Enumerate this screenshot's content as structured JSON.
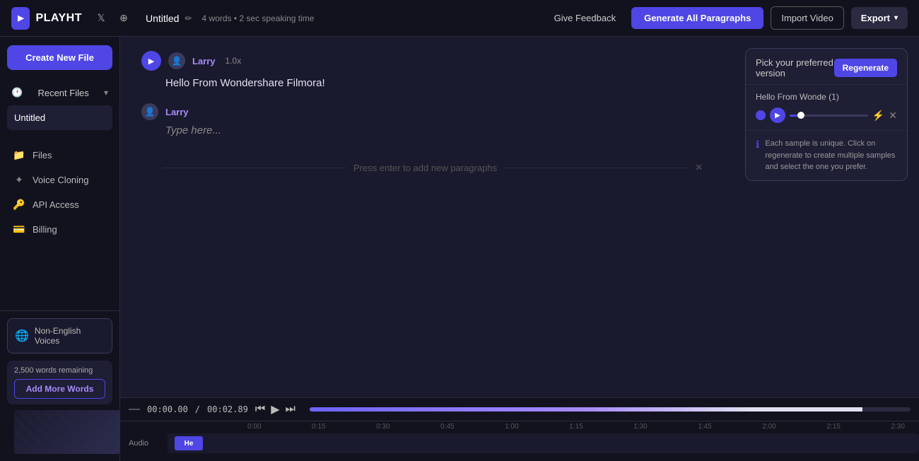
{
  "topbar": {
    "logo_text": "PLAYHT",
    "file_title": "Untitled",
    "file_meta": "4 words • 2 sec speaking time",
    "give_feedback_label": "Give Feedback",
    "generate_label": "Generate All Paragraphs",
    "import_label": "Import Video",
    "export_label": "Export"
  },
  "sidebar": {
    "create_new_label": "Create New File",
    "recent_files_label": "Recent Files",
    "recent_file_name": "Untitled",
    "nav_items": [
      {
        "label": "Files",
        "icon": "📁"
      },
      {
        "label": "Voice Cloning",
        "icon": "✨"
      },
      {
        "label": "API Access",
        "icon": "🔑"
      },
      {
        "label": "Billing",
        "icon": "💳"
      }
    ],
    "non_english_label": "Non-English Voices",
    "words_remaining": "2,500 words remaining",
    "add_more_words_label": "Add More Words"
  },
  "editor": {
    "paragraph1": {
      "speaker": "Larry",
      "speed": "1.0x",
      "text": "Hello From Wondershare Filmora!"
    },
    "paragraph2": {
      "speaker": "Larry",
      "placeholder": "Type here..."
    },
    "press_enter_hint": "Press enter to add new paragraphs"
  },
  "popup": {
    "title": "Pick your preferred version",
    "regenerate_label": "Regenerate",
    "sample_title": "Hello From Wonde (1)",
    "info_text": "Each sample is unique. Click on regenerate to create multiple samples and select the one you prefer."
  },
  "timeline": {
    "time_current": "00:00.00",
    "time_total": "00:02.89",
    "ruler_marks": [
      "0:00",
      "0:15",
      "0:30",
      "0:45",
      "1:00",
      "1:15",
      "1:30",
      "1:45",
      "2:00",
      "2:15",
      "2:30"
    ],
    "track_label": "Audio",
    "track_block_label": "He"
  }
}
